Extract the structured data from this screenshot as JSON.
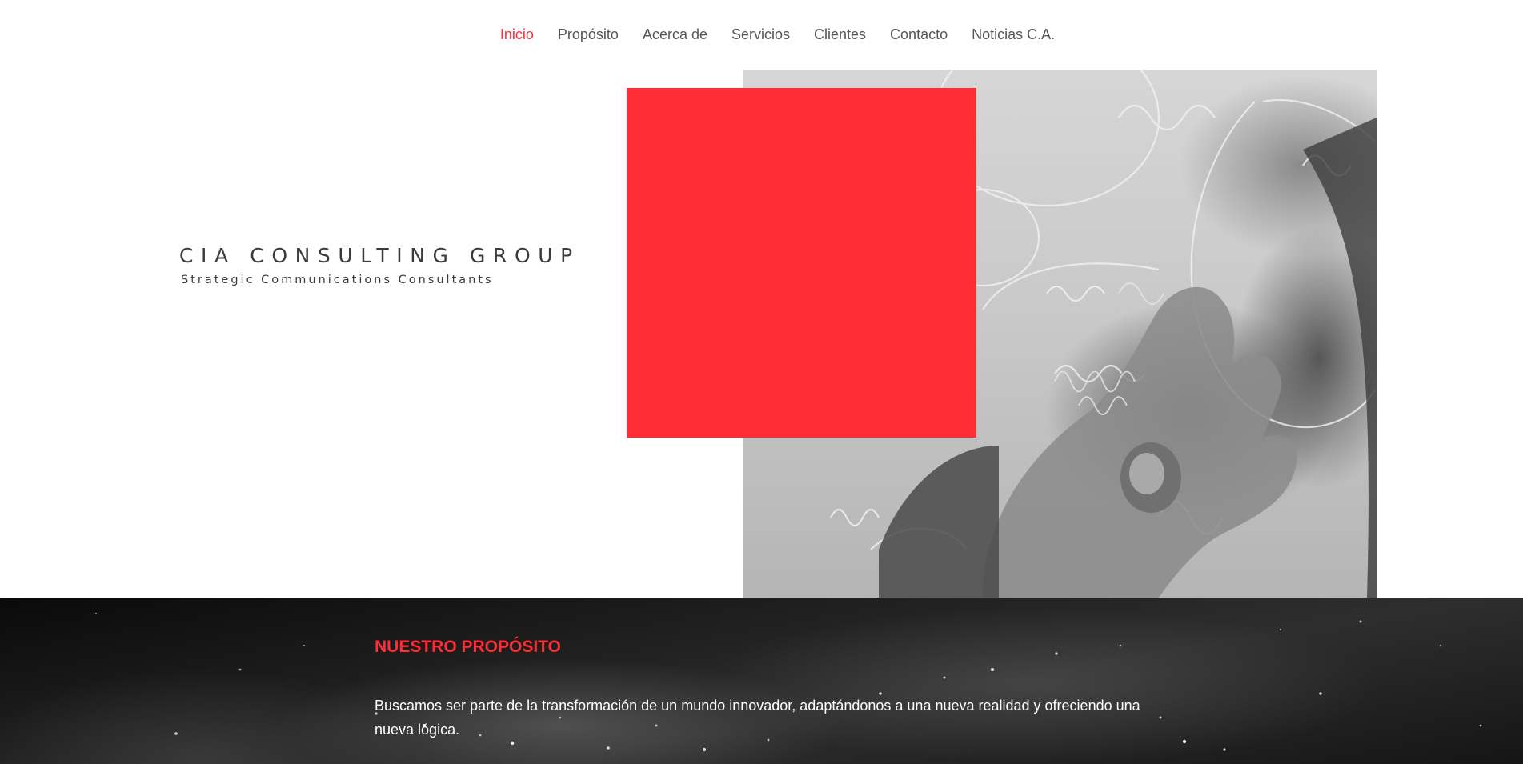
{
  "nav": {
    "items": [
      {
        "label": "Inicio",
        "active": true
      },
      {
        "label": "Propósito",
        "active": false
      },
      {
        "label": "Acerca de",
        "active": false
      },
      {
        "label": "Servicios",
        "active": false
      },
      {
        "label": "Clientes",
        "active": false
      },
      {
        "label": "Contacto",
        "active": false
      },
      {
        "label": "Noticias C.A.",
        "active": false
      }
    ]
  },
  "hero": {
    "brand_title": "CIA CONSULTING GROUP",
    "brand_subtitle": "Strategic Communications Consultants",
    "photo_icon": "hand-writing-on-glass-image"
  },
  "purpose": {
    "heading": "NUESTRO PROPÓSITO",
    "text": "Buscamos ser parte de la transformación de un mundo innovador, adaptándonos a una nueva realidad y ofreciendo una nueva lógica."
  },
  "colors": {
    "accent": "#ff2d36",
    "text_dark": "#3b3b3b",
    "nav_text": "#555555",
    "band_text": "#ffffff"
  }
}
